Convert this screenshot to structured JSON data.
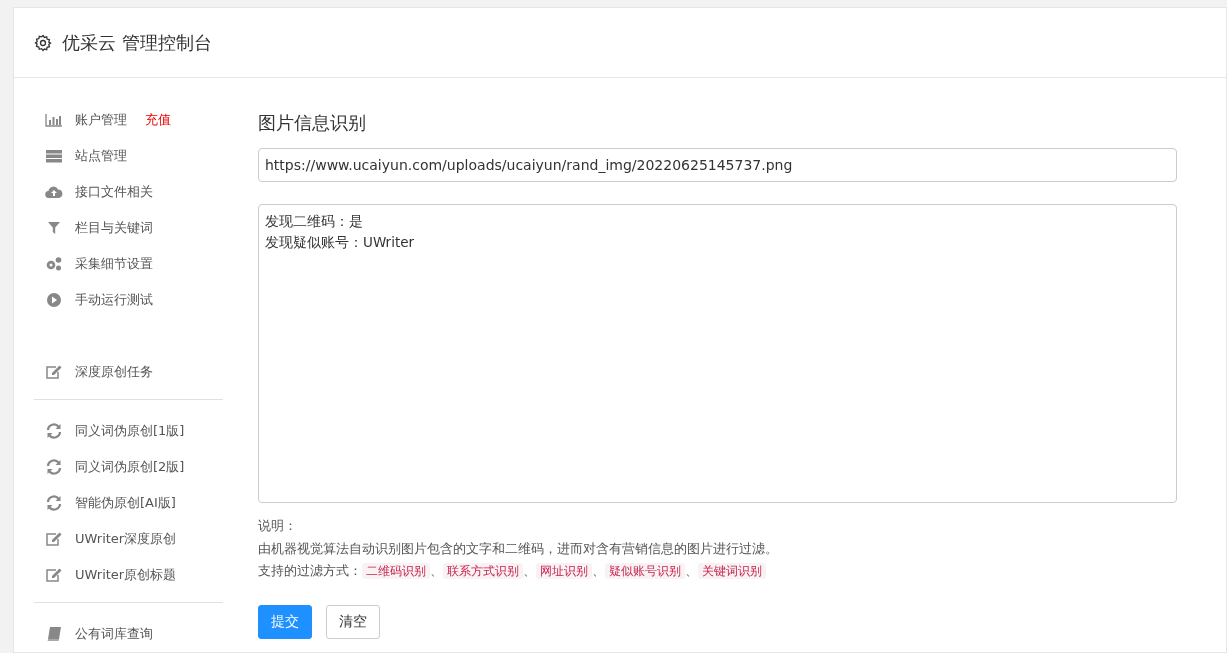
{
  "header": {
    "title": "优采云 管理控制台"
  },
  "sidebar": {
    "groups": [
      {
        "items": [
          {
            "label": "账户管理",
            "badge": "充值"
          },
          {
            "label": "站点管理"
          },
          {
            "label": "接口文件相关"
          },
          {
            "label": "栏目与关键词"
          },
          {
            "label": "采集细节设置"
          },
          {
            "label": "手动运行测试"
          },
          {
            "label": "深度原创任务"
          }
        ]
      },
      {
        "items": [
          {
            "label": "同义词伪原创[1版]"
          },
          {
            "label": "同义词伪原创[2版]"
          },
          {
            "label": "智能伪原创[AI版]"
          },
          {
            "label": "UWriter深度原创"
          },
          {
            "label": "UWriter原创标题"
          }
        ]
      },
      {
        "items": [
          {
            "label": "公有词库查询"
          }
        ]
      }
    ]
  },
  "main": {
    "title": "图片信息识别",
    "url_field": {
      "value": "https://www.ucaiyun.com/uploads/ucaiyun/rand_img/20220625145737.png"
    },
    "result_box": {
      "lines": [
        "发现二维码：是",
        "发现疑似账号：UWriter"
      ]
    },
    "note_label": "说明：",
    "note_text": "由机器视觉算法自动识别图片包含的文字和二维码，进而对含有营销信息的图片进行过滤。",
    "filters_label": "支持的过滤方式：",
    "filters": [
      "二维码识别",
      "联系方式识别",
      "网址识别",
      "疑似账号识别",
      "关键词识别"
    ],
    "separator": "、",
    "buttons": [
      {
        "label": "提交",
        "kind": "primary"
      },
      {
        "label": "清空",
        "kind": "default"
      }
    ]
  }
}
